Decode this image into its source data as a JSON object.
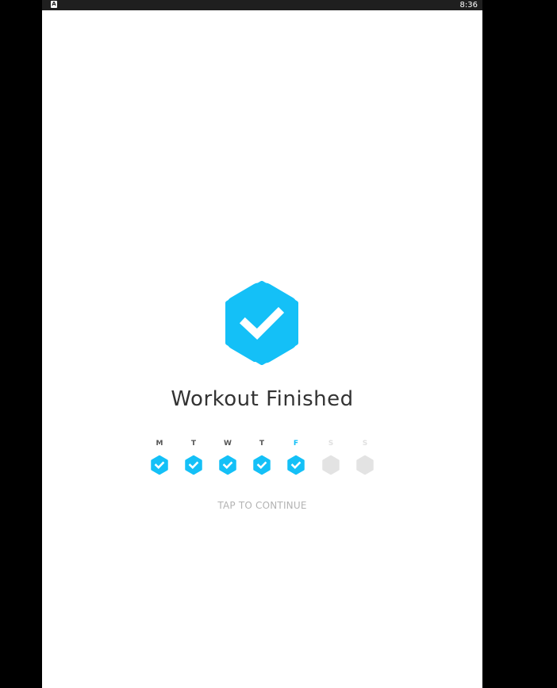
{
  "status_bar": {
    "notification_icon": "A",
    "time": "8:36"
  },
  "workout": {
    "title": "Workout Finished",
    "tap_text": "TAP TO CONTINUE"
  },
  "week": [
    {
      "letter": "M",
      "state": "completed"
    },
    {
      "letter": "T",
      "state": "completed"
    },
    {
      "letter": "W",
      "state": "completed"
    },
    {
      "letter": "T",
      "state": "completed"
    },
    {
      "letter": "F",
      "state": "today-completed"
    },
    {
      "letter": "S",
      "state": "pending"
    },
    {
      "letter": "S",
      "state": "pending"
    }
  ],
  "colors": {
    "accent": "#14c0f7",
    "pending": "#e3e3e3",
    "letter_dark": "#555555",
    "letter_pending": "#e0e0e0",
    "title": "#333333",
    "tap_text": "#b3b3b3"
  }
}
